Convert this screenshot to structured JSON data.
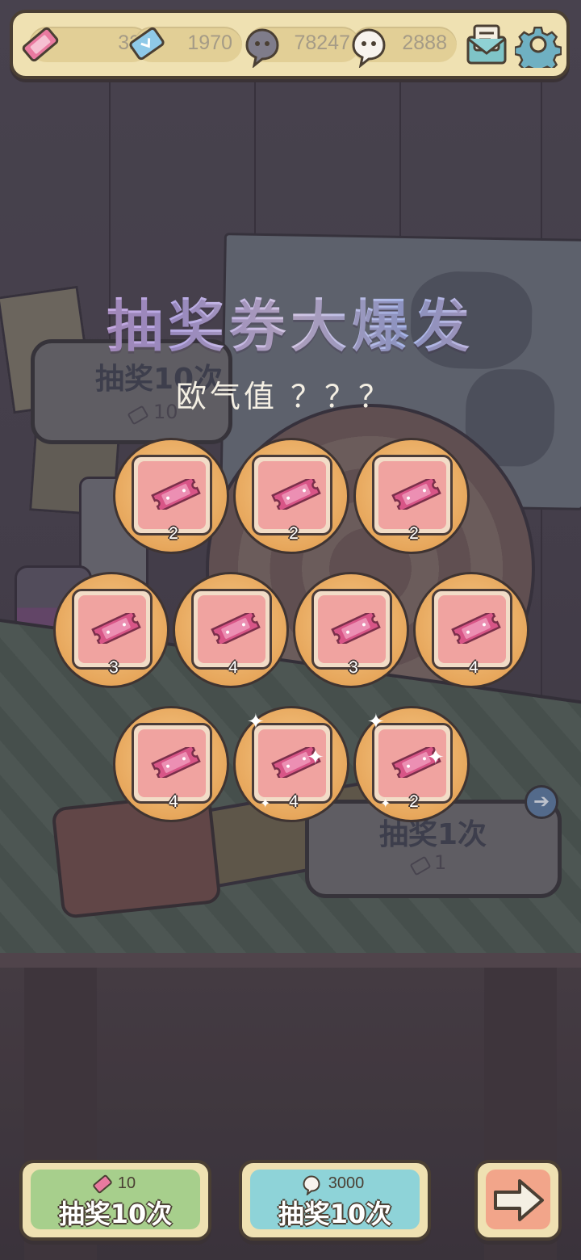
{
  "currency": {
    "tickets": "32",
    "crystals": "1970",
    "ghost_gray": "78247",
    "ghost_white": "2888"
  },
  "icons": {
    "ticket": "ticket-icon",
    "crystal": "crystal-icon",
    "ghost_gray": "gray-ghost-icon",
    "ghost_white": "white-ghost-icon",
    "mail": "mail-icon",
    "settings": "gear-icon",
    "next": "arrow-right-icon"
  },
  "overlay": {
    "title": "抽奖券大爆发",
    "luck": "欧气值 ？？？"
  },
  "background": {
    "draw10_label": "抽奖10次",
    "draw10_cost": "10",
    "draw1_label": "抽奖1次",
    "draw1_cost": "1"
  },
  "rewards": [
    {
      "count": "2"
    },
    {
      "count": "2"
    },
    {
      "count": "2"
    },
    {
      "count": "3"
    },
    {
      "count": "4"
    },
    {
      "count": "3"
    },
    {
      "count": "4"
    },
    {
      "count": "4"
    },
    {
      "count": "4"
    },
    {
      "count": "2"
    }
  ],
  "buttons": {
    "ticket_draw": {
      "cost": "10",
      "label": "抽奖10次"
    },
    "ghost_draw": {
      "cost": "3000",
      "label": "抽奖10次"
    }
  },
  "colors": {
    "bar": "#efe1b2",
    "reward_circle": "#e7a75c",
    "card_pink": "#f0a3a0",
    "green_button": "#a7cf8c",
    "blue_button": "#8ed3d8",
    "orange_button": "#f2a58a"
  }
}
